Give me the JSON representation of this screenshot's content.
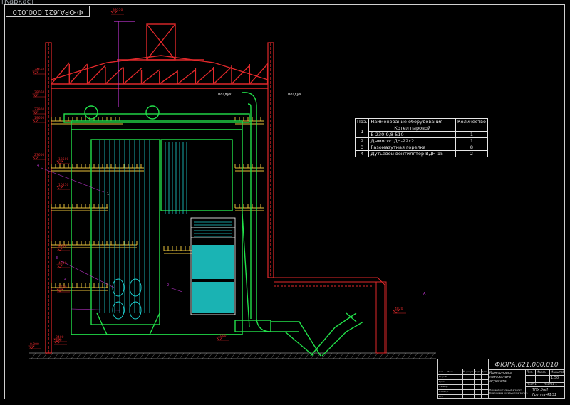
{
  "window": {
    "tab_title": "[Каркас]"
  },
  "frame": {
    "top_stamp": "ФЮРА.621.000.010"
  },
  "colors": {
    "background": "#000000",
    "structure": "#e0282a",
    "boiler": "#22e04a",
    "tubes": "#1fd3d3",
    "text": "#e6e6e6",
    "mark": "#b833c9"
  },
  "spec_table": {
    "headers": [
      "Поз.",
      "Наименование оборудования",
      "Количество"
    ],
    "rows": [
      {
        "pos": "1",
        "name_lines": [
          "Котел паровой",
          "Е-230-9,8-510"
        ],
        "qty": "1"
      },
      {
        "pos": "2",
        "name_lines": [
          "Дымосос ДН-22х2"
        ],
        "qty": "1"
      },
      {
        "pos": "3",
        "name_lines": [
          "Газомазутная горелка"
        ],
        "qty": "8"
      },
      {
        "pos": "4",
        "name_lines": [
          "Дутьевой вентилятор ВДН-15"
        ],
        "qty": "2"
      }
    ]
  },
  "title_block": {
    "code": "ФЮРА.621.000.010",
    "name": "Компоновка котельного агрегата",
    "col_lit": "Лит.",
    "col_mass": "Масса",
    "col_scale": "Масштаб",
    "scale": "1:50",
    "sheet": "Лист 1",
    "sheets": "Листов 1",
    "org1": "ТПУ ЭнИ",
    "org2": "Группа 4ФЗ1",
    "note": "Паровой котельный агрегат. Компоновка котельного агрегата",
    "row_labels": [
      "Изм",
      "Лист",
      "№ докум.",
      "Подп.",
      "Дата",
      "Разраб.",
      "Пров.",
      "Т.контр.",
      "Н.контр.",
      "Утв."
    ]
  },
  "labels": {
    "air_in_left": "Воздух",
    "air_in_right": "Воздух",
    "pos_4": "4",
    "pos_1": "1",
    "pos_3": "3",
    "pos_2": "2",
    "section_a1": "А",
    "section_a2": "А",
    "elevations": [
      "39550",
      "34650",
      "28060",
      "22900",
      "19600",
      "13500",
      "10450",
      "6600",
      "4200",
      "3600",
      "0.000",
      "27600",
      "4820",
      "1000",
      "3400",
      "500"
    ]
  }
}
